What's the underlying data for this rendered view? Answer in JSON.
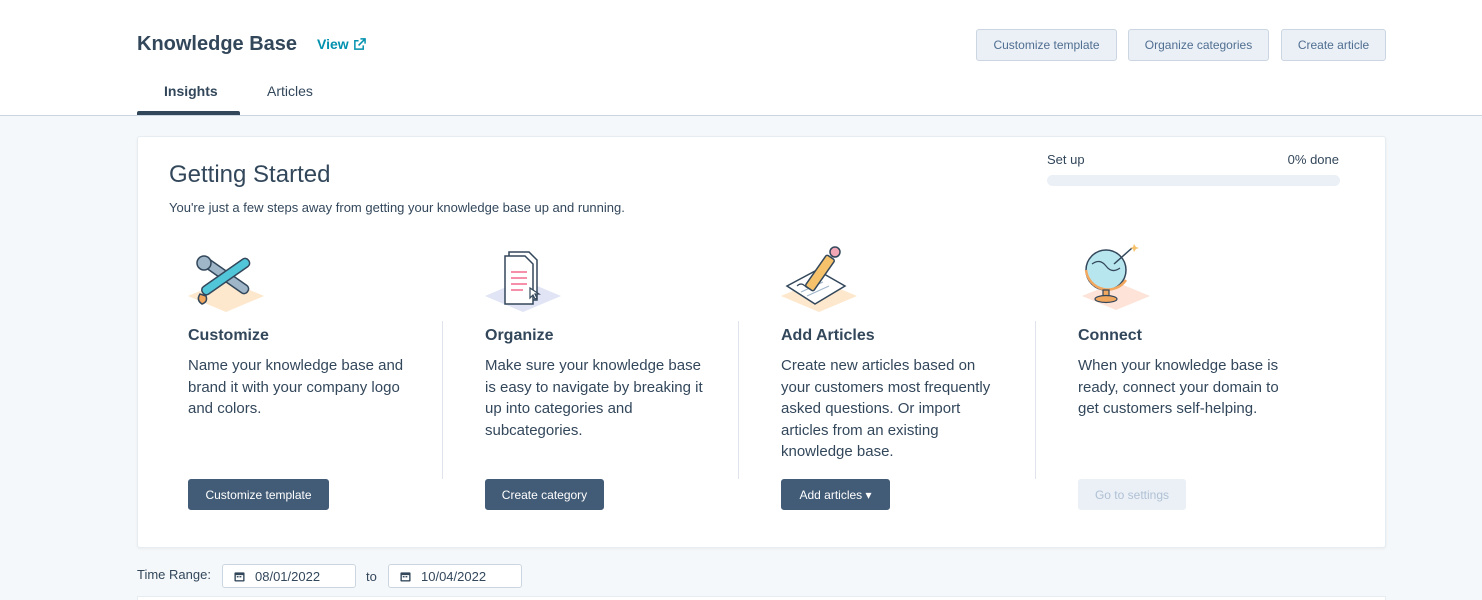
{
  "header": {
    "title": "Knowledge Base",
    "view_label": "View",
    "buttons": {
      "customize_template": "Customize template",
      "organize_categories": "Organize categories",
      "create_article": "Create article"
    },
    "tabs": [
      {
        "label": "Insights",
        "active": true
      },
      {
        "label": "Articles",
        "active": false
      }
    ]
  },
  "getting_started": {
    "title": "Getting Started",
    "subtitle": "You're just a few steps away from getting your knowledge base up and running.",
    "progress": {
      "label": "Set up",
      "done_text": "0% done",
      "percent": 0
    },
    "steps": [
      {
        "icon": "tools-icon",
        "title": "Customize",
        "description": "Name your knowledge base and brand it with your company logo and colors.",
        "button": "Customize template",
        "button_enabled": true
      },
      {
        "icon": "document-icon",
        "title": "Organize",
        "description": "Make sure your knowledge base is easy to navigate by breaking it up into categories and subcategories.",
        "button": "Create category",
        "button_enabled": true
      },
      {
        "icon": "pencil-paper-icon",
        "title": "Add Articles",
        "description": "Create new articles based on your customers most frequently asked questions. Or import articles from an existing knowledge base.",
        "button": "Add articles ▾",
        "button_enabled": true
      },
      {
        "icon": "globe-icon",
        "title": "Connect",
        "description": "When your knowledge base is ready, connect your domain to get customers self-helping.",
        "button": "Go to settings",
        "button_enabled": false
      }
    ]
  },
  "time_range": {
    "label": "Time Range:",
    "from": "08/01/2022",
    "to_label": "to",
    "to": "10/04/2022"
  },
  "colors": {
    "link": "#0091ae",
    "primary_button": "#425b76",
    "text": "#33475b",
    "background": "#f5f8fa"
  }
}
